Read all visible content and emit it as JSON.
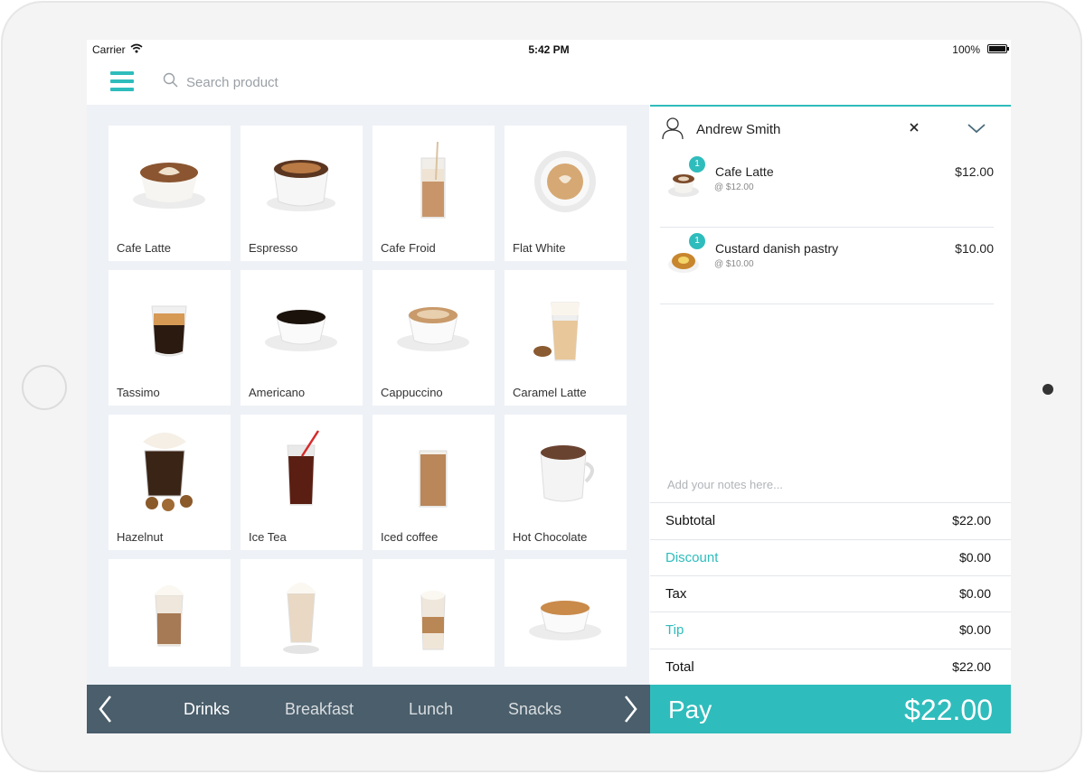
{
  "status": {
    "carrier": "Carrier",
    "time": "5:42 PM",
    "battery": "100%"
  },
  "search": {
    "placeholder": "Search product"
  },
  "products": [
    {
      "name": "Cafe Latte"
    },
    {
      "name": "Espresso"
    },
    {
      "name": "Cafe Froid"
    },
    {
      "name": "Flat White"
    },
    {
      "name": "Tassimo"
    },
    {
      "name": "Americano"
    },
    {
      "name": "Cappuccino"
    },
    {
      "name": "Caramel Latte"
    },
    {
      "name": "Hazelnut"
    },
    {
      "name": "Ice Tea"
    },
    {
      "name": "Iced coffee"
    },
    {
      "name": "Hot Chocolate"
    },
    {
      "name": ""
    },
    {
      "name": ""
    },
    {
      "name": ""
    },
    {
      "name": ""
    }
  ],
  "categories": [
    "Drinks",
    "Breakfast",
    "Lunch",
    "Snacks"
  ],
  "active_category": "Drinks",
  "customer": {
    "name": "Andrew Smith"
  },
  "order": {
    "items": [
      {
        "qty": "1",
        "name": "Cafe Latte",
        "unit": "@ $12.00",
        "price": "$12.00"
      },
      {
        "qty": "1",
        "name": "Custard danish pastry",
        "unit": "@ $10.00",
        "price": "$10.00"
      }
    ],
    "notes_placeholder": "Add your notes here..."
  },
  "totals": {
    "subtotal_label": "Subtotal",
    "subtotal": "$22.00",
    "discount_label": "Discount",
    "discount": "$0.00",
    "tax_label": "Tax",
    "tax": "$0.00",
    "tip_label": "Tip",
    "tip": "$0.00",
    "total_label": "Total",
    "total": "$22.00"
  },
  "pay": {
    "label": "Pay",
    "amount": "$22.00"
  },
  "colors": {
    "accent": "#2fbcbc",
    "category_bar": "#4a5e6b",
    "grid_bg": "#eef1f6"
  }
}
